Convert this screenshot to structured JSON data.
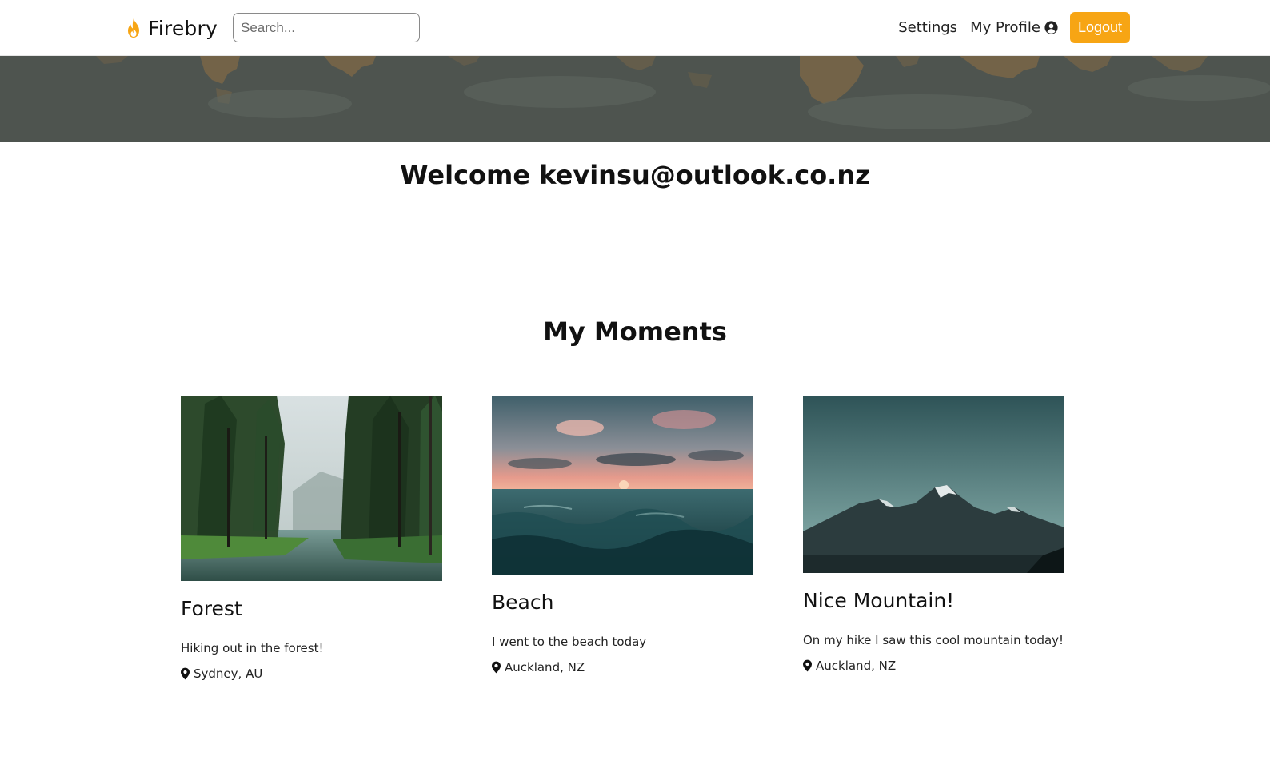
{
  "navbar": {
    "brand": "Firebry",
    "brand_icon": "flame-icon",
    "search_placeholder": "Search...",
    "settings_label": "Settings",
    "profile_label": "My Profile",
    "profile_icon": "user-circle-icon",
    "logout_label": "Logout",
    "accent_color": "#f7a514"
  },
  "welcome": {
    "text": "Welcome kevinsu@outlook.co.nz"
  },
  "moments": {
    "title": "My Moments",
    "cards": [
      {
        "title": "Forest",
        "description": "Hiking out in the forest!",
        "location": "Sydney, AU",
        "image": "forest-photo"
      },
      {
        "title": "Beach",
        "description": "I went to the beach today",
        "location": "Auckland, NZ",
        "image": "beach-photo"
      },
      {
        "title": "Nice Mountain!",
        "description": "On my hike I saw this cool mountain today!",
        "location": "Auckland, NZ",
        "image": "mountain-photo"
      }
    ]
  }
}
